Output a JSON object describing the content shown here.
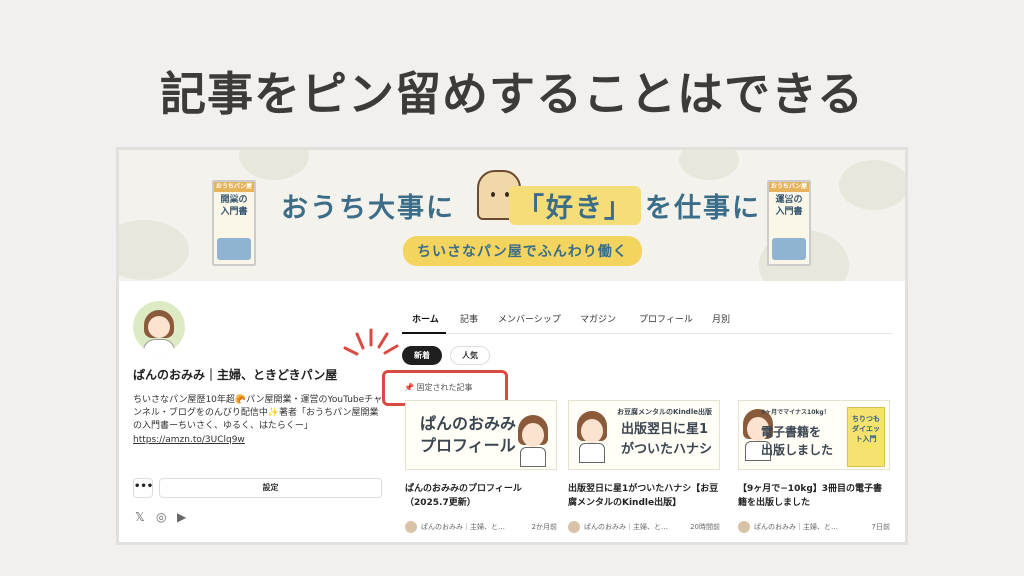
{
  "slide_title": "記事をピン留めすることはできる",
  "banner": {
    "title_left": "おうち大事に",
    "title_highlight": "「好き」",
    "title_right": "を仕事に",
    "subtitle": "ちいさなパン屋でふんわり働く",
    "book_left_title": "開業の入門書",
    "book_left_top": "おうちパン屋の",
    "book_right_title": "運営の入門書",
    "book_right_top": "おうちパン屋の"
  },
  "profile": {
    "name": "ぱんのおみみ｜主婦、ときどきパン屋",
    "bio": "ちいさなパン屋歴10年超🥐パン屋開業・運営のYouTubeチャンネル・ブログをのんびり配信中✨著者「おうちパン屋開業の入門書ーちいさく、ゆるく、はたらくー」",
    "link": "https://amzn.to/3UClq9w",
    "more_label": "•••",
    "settings_label": "設定"
  },
  "social": {
    "x_glyph": "𝕏",
    "instagram_glyph": "◎",
    "youtube_glyph": "▶"
  },
  "tabs": [
    "ホーム",
    "記事",
    "メンバーシップ",
    "マガジン",
    "プロフィール",
    "月別"
  ],
  "filters": {
    "new": "新着",
    "popular": "人気"
  },
  "pinned_label": "📌 固定された記事",
  "cards": [
    {
      "thumb_text": "ぱんのおみみ\nプロフィール",
      "thumb_line1": "ぱんのおみみ",
      "thumb_line2": "プロフィール",
      "title": "ぱんのおみみのプロフィール（2025.7更新）",
      "author": "ぱんのおみみ｜主婦、と…",
      "time": "2か月前"
    },
    {
      "thumb_caption": "お豆腐メンタルのKindle出版",
      "thumb_line1": "出版翌日に星1",
      "thumb_line2": "がついたハナシ",
      "title": "出版翌日に星1がついたハナシ【お豆腐メンタルのKindle出版】",
      "author": "ぱんのおみみ｜主婦、と…",
      "time": "20時間前"
    },
    {
      "thumb_caption": "9ヶ月でマイナス10kg！",
      "thumb_line1": "電子書籍を",
      "thumb_line2": "出版しました",
      "thumb_book": "ちりつもダイエット入門",
      "title": "【9ヶ月で−10kg】3冊目の電子書籍を出版しました",
      "author": "ぱんのおみみ｜主婦、と…",
      "time": "7日前"
    }
  ],
  "colors": {
    "accent_red": "#d94a43",
    "banner_blue": "#3b6d89",
    "banner_yellow": "#f3d45f"
  }
}
